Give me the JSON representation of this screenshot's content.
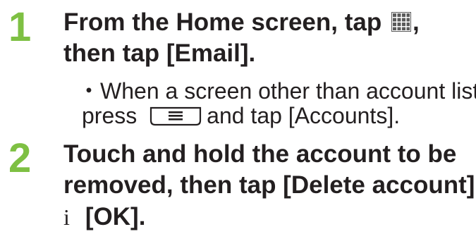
{
  "steps": [
    {
      "number": "1",
      "line1_before": "From the Home screen, tap ",
      "line1_icon": "apps-grid-icon",
      "line1_after": ",",
      "line2": "then tap [Email].",
      "note_bullet": "・",
      "note_line1": "When a screen other than account list,",
      "note_line2_before": "press ",
      "note_line2_icon": "menu-key-icon",
      "note_line2_after": "and tap [Accounts]."
    },
    {
      "number": "2",
      "line1": "Touch and hold the account to be",
      "line2": "removed, then tap [Delete account]",
      "line3_arrow": "i",
      "line3": "[OK]."
    }
  ],
  "colors": {
    "step_number": "#7ec043",
    "text": "#231f20",
    "icon": "#5a5a5a"
  }
}
